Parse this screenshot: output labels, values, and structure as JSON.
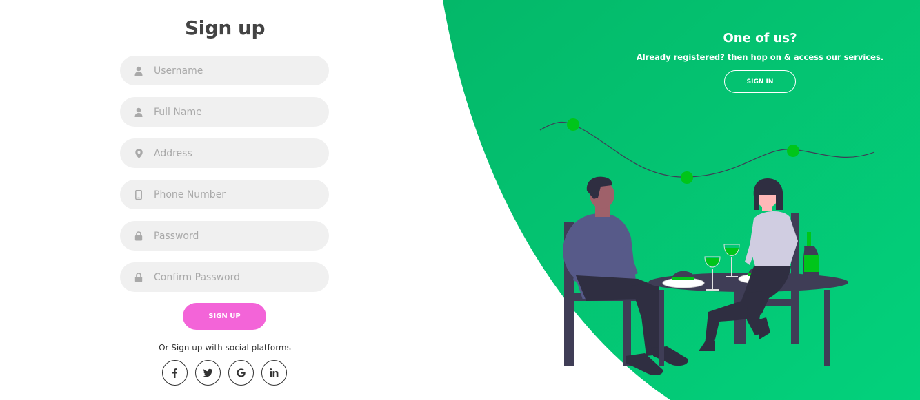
{
  "signup": {
    "title": "Sign up",
    "fields": [
      {
        "icon": "user-icon",
        "placeholder": "Username",
        "value": ""
      },
      {
        "icon": "user-icon",
        "placeholder": "Full Name",
        "value": ""
      },
      {
        "icon": "location-pin-icon",
        "placeholder": "Address",
        "value": ""
      },
      {
        "icon": "mobile-phone-icon",
        "placeholder": "Phone Number",
        "value": ""
      },
      {
        "icon": "lock-icon",
        "placeholder": "Password",
        "value": ""
      },
      {
        "icon": "lock-icon",
        "placeholder": "Confirm Password",
        "value": ""
      }
    ],
    "button_label": "SIGN UP",
    "social_text": "Or Sign up with social platforms",
    "social": [
      {
        "icon": "facebook-icon"
      },
      {
        "icon": "twitter-icon"
      },
      {
        "icon": "google-icon"
      },
      {
        "icon": "linkedin-icon"
      }
    ]
  },
  "panel": {
    "title": "One of us?",
    "text": "Already registered? then hop on & access our services.",
    "button_label": "SIGN IN"
  },
  "colors": {
    "accent_green_start": "#04b869",
    "accent_green_end": "#03d17c",
    "signup_button": "#f364d8",
    "input_background": "#f0f0f0"
  }
}
